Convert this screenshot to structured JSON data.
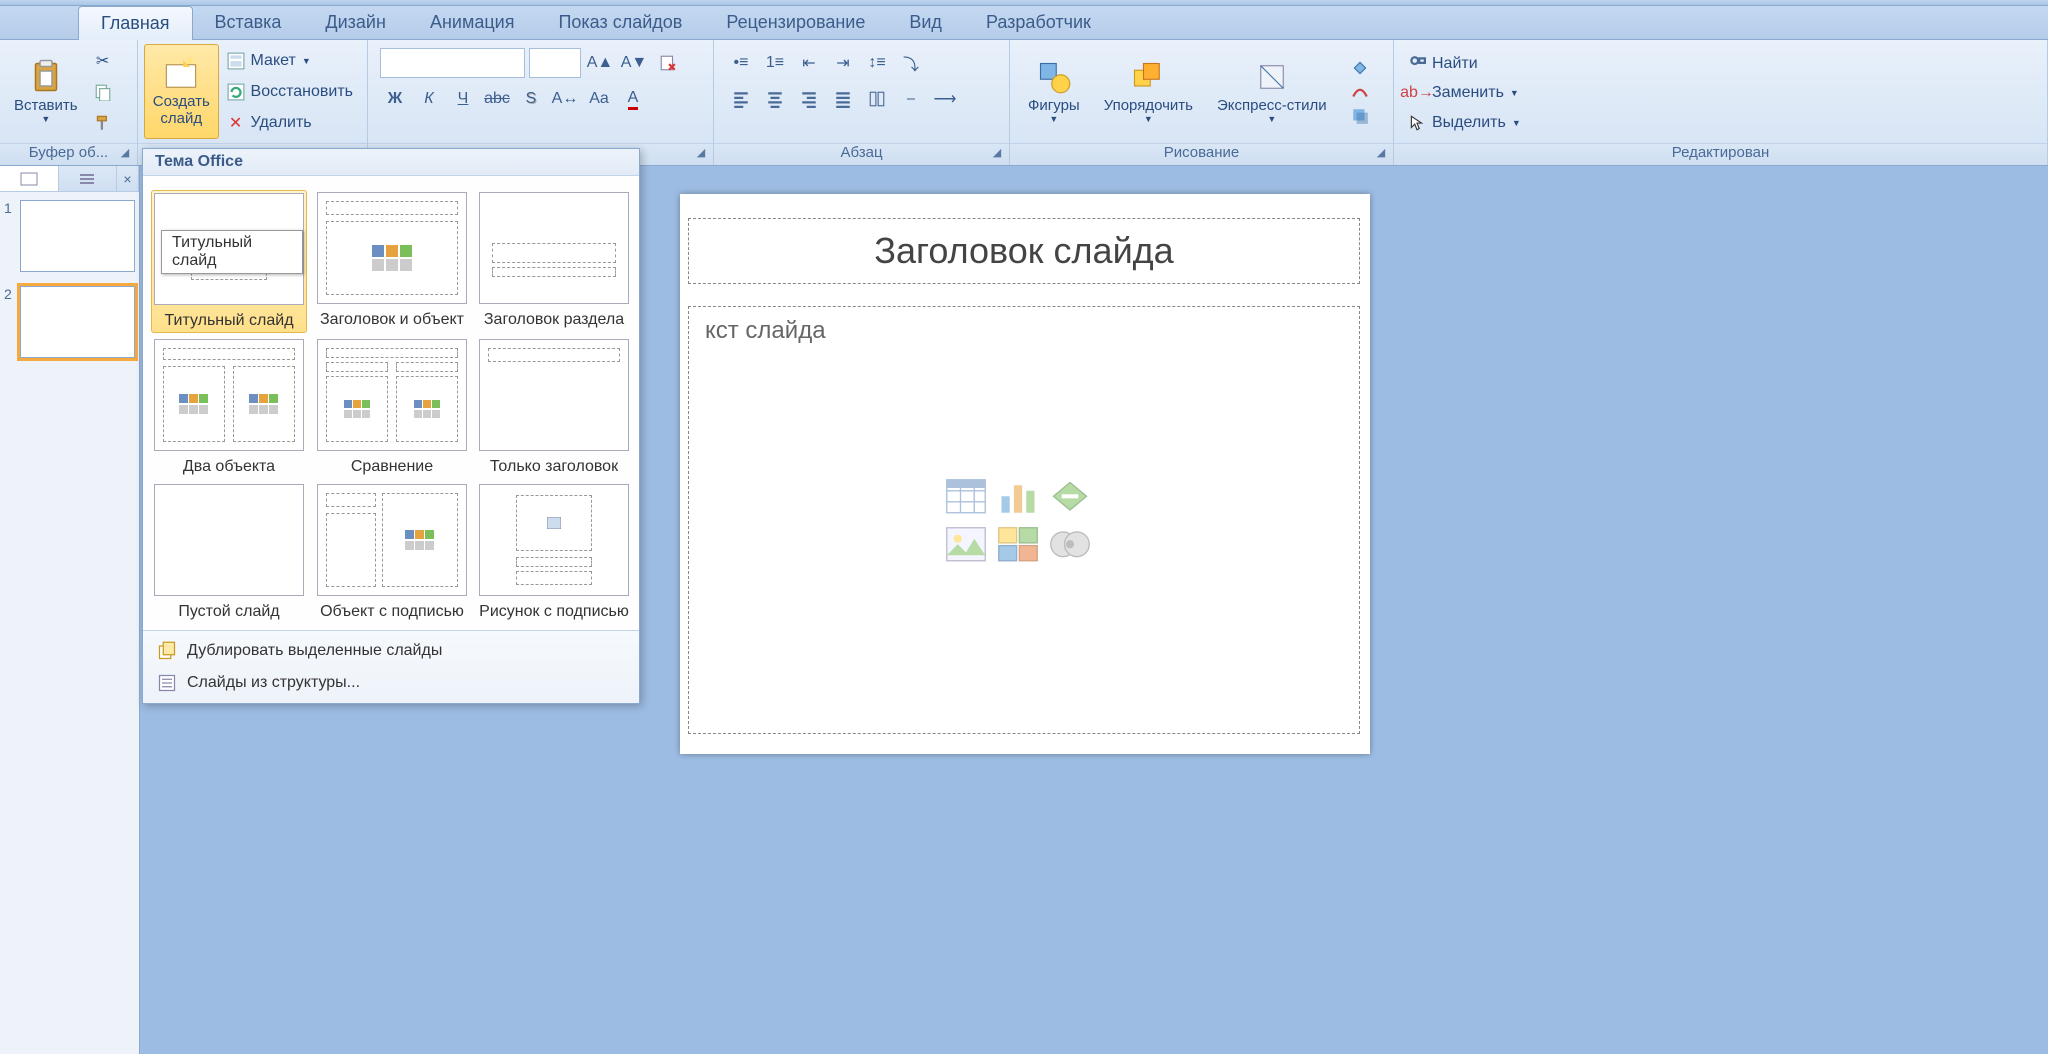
{
  "tabs": [
    "Главная",
    "Вставка",
    "Дизайн",
    "Анимация",
    "Показ слайдов",
    "Рецензирование",
    "Вид",
    "Разработчик"
  ],
  "activeTab": 0,
  "ribbon": {
    "clipboard": {
      "label": "Буфер об...",
      "paste": "Вставить"
    },
    "slides": {
      "label": "",
      "newSlide": "Создать слайд",
      "layout": "Макет",
      "reset": "Восстановить",
      "delete": "Удалить"
    },
    "font": {
      "label": ""
    },
    "paragraph": {
      "label": "Абзац"
    },
    "drawing": {
      "label": "Рисование",
      "shapes": "Фигуры",
      "arrange": "Упорядочить",
      "quick": "Экспресс-стили"
    },
    "editing": {
      "label": "Редактирован",
      "find": "Найти",
      "replace": "Заменить",
      "select": "Выделить"
    }
  },
  "thumbnails": {
    "count": 2,
    "selected": 2
  },
  "slide": {
    "title": "Заголовок слайда",
    "body": "кст слайда"
  },
  "gallery": {
    "header": "Тема Office",
    "tooltip": "Титульный слайд",
    "layouts": [
      "Титульный слайд",
      "Заголовок и объект",
      "Заголовок раздела",
      "Два объекта",
      "Сравнение",
      "Только заголовок",
      "Пустой слайд",
      "Объект с подписью",
      "Рисунок с подписью"
    ],
    "footerItems": [
      "Дублировать выделенные слайды",
      "Слайды из структуры..."
    ]
  }
}
